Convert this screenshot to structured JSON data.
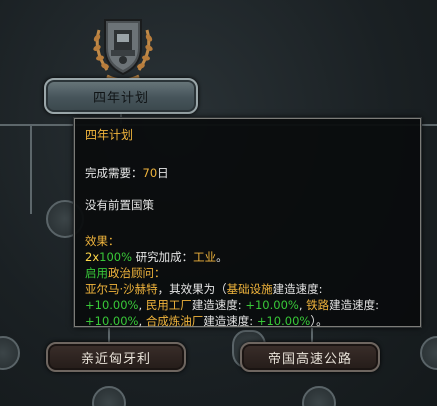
{
  "focus": {
    "name": "四年计划"
  },
  "tooltip": {
    "title": "四年计划",
    "completion_label": "完成需要：",
    "completion_days": "70",
    "completion_unit": "日",
    "prereq": "没有前置国策",
    "effects_label": "效果：",
    "effect1_mult": "2x",
    "effect1_pct": "100%",
    "effect1_text": " 研究加成：",
    "effect1_target": "工业",
    "effect1_end": "。",
    "advisor_enable": "启用",
    "advisor_title": "政治顾问：",
    "advisor_name": "亚尔马·沙赫特",
    "advisor_text1": "，其效果为（",
    "advisor_k1": "基础设施",
    "advisor_t1": "建造速度:",
    "advisor_v1": "+10.00%",
    "advisor_sep1": ", ",
    "advisor_k2": "民用工厂",
    "advisor_t2": "建造速度: ",
    "advisor_v2": "+10.00%",
    "advisor_sep2": ", ",
    "advisor_k3": "铁路",
    "advisor_t3": "建造速度:",
    "advisor_v3": "+10.00%",
    "advisor_sep3": ", ",
    "advisor_k4": "合成炼油厂",
    "advisor_t4": "建造速度: ",
    "advisor_v4": "+10.00%",
    "advisor_end": "）。"
  },
  "nodes": {
    "left_label": "亲近匈牙利",
    "right_label": "帝国高速公路"
  },
  "colors": {
    "gold": "#f0b43c",
    "green": "#38c838",
    "yellow": "#ffd84a"
  }
}
